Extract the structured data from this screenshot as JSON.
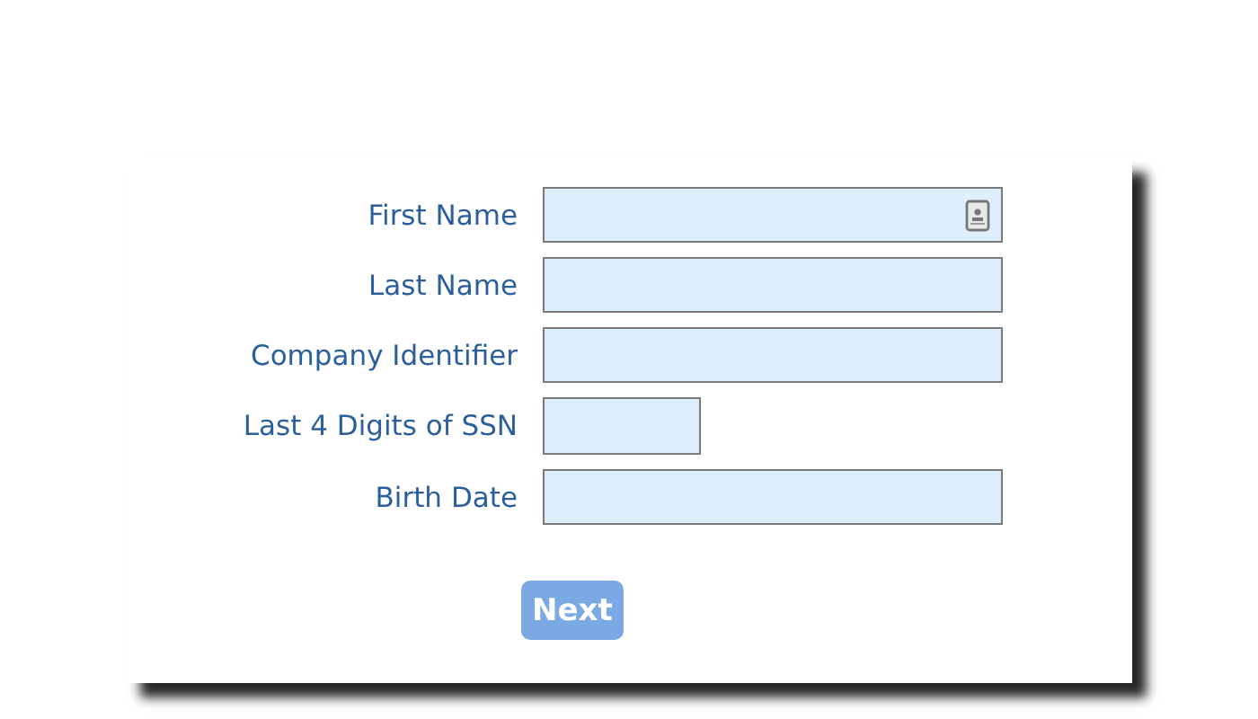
{
  "fields": [
    {
      "label": "First Name",
      "kind": "wide",
      "contact_icon": true
    },
    {
      "label": "Last Name",
      "kind": "wide",
      "contact_icon": false
    },
    {
      "label": "Company Identifier",
      "kind": "wide",
      "contact_icon": false
    },
    {
      "label": "Last 4 Digits of SSN",
      "kind": "short",
      "contact_icon": false
    },
    {
      "label": "Birth Date",
      "kind": "wide",
      "contact_icon": false
    }
  ],
  "next_button": {
    "label": "Next",
    "disabled": true
  }
}
